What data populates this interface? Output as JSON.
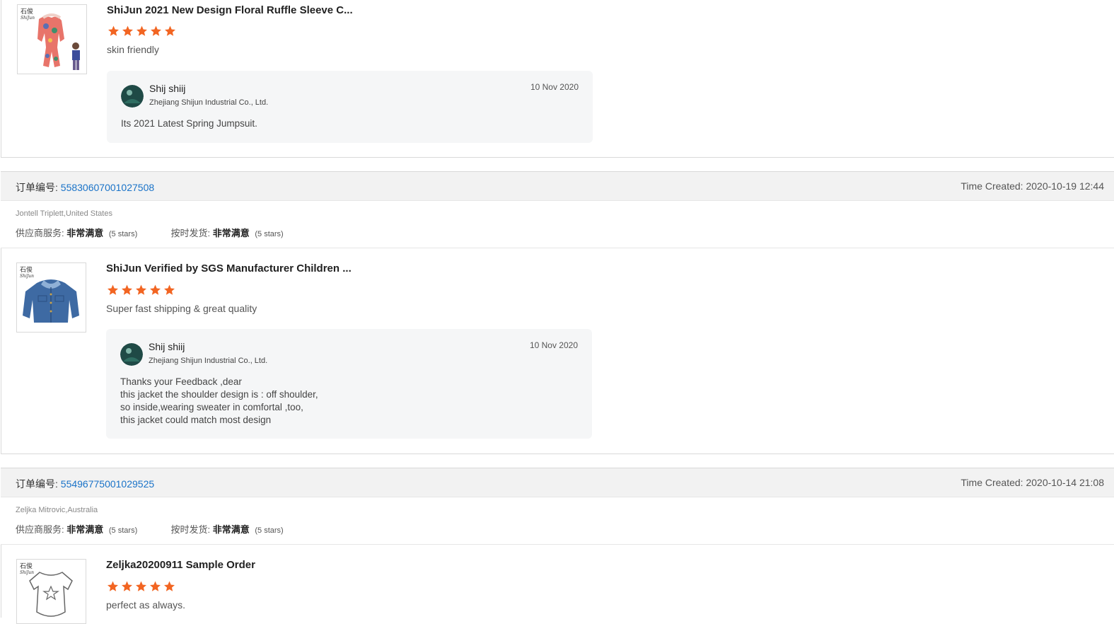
{
  "reviews": [
    {
      "product_title": "ShiJun 2021 New Design Floral Ruffle Sleeve C...",
      "stars": 5,
      "review_text": "skin friendly",
      "thumb_brand": "石俊 ShiJun",
      "reply": {
        "seller_name": "Shij shiij",
        "seller_company": "Zhejiang Shijun Industrial Co., Ltd.",
        "date": "10 Nov 2020",
        "text": "Its 2021 Latest Spring Jumpsuit."
      }
    },
    {
      "order_label": "订单编号:",
      "order_id": "55830607001027508",
      "time_created": "Time Created: 2020-10-19 12:44",
      "buyer": "Jontell Triplett,United States",
      "supplier_service_label": "供应商服务:",
      "supplier_service_value": "非常满意",
      "supplier_service_stars": "(5 stars)",
      "on_time_label": "按时发货:",
      "on_time_value": "非常满意",
      "on_time_stars": "(5 stars)",
      "product_title": "ShiJun Verified by SGS Manufacturer Children ...",
      "stars": 5,
      "review_text": "Super fast shipping & great quality",
      "thumb_brand": "石俊 ShiJun",
      "reply": {
        "seller_name": "Shij shiij",
        "seller_company": "Zhejiang Shijun Industrial Co., Ltd.",
        "date": "10 Nov 2020",
        "text": "Thanks your Feedback ,dear\nthis jacket the shoulder design is : off shoulder,\nso inside,wearing sweater in comfortal ,too,\nthis jacket could match most design"
      }
    },
    {
      "order_label": "订单编号:",
      "order_id": "55496775001029525",
      "time_created": "Time Created: 2020-10-14 21:08",
      "buyer": "Zeljka Mitrovic,Australia",
      "supplier_service_label": "供应商服务:",
      "supplier_service_value": "非常满意",
      "supplier_service_stars": "(5 stars)",
      "on_time_label": "按时发货:",
      "on_time_value": "非常满意",
      "on_time_stars": "(5 stars)",
      "product_title": "Zeljka20200911 Sample Order",
      "stars": 5,
      "review_text": "perfect as always.",
      "thumb_brand": "石俊 ShiJun"
    }
  ],
  "colors": {
    "star": "#f26522",
    "link": "#1a73c8",
    "header_bg": "#f2f2f2",
    "reply_bg": "#f5f6f7"
  },
  "icons": {
    "star": "star-icon",
    "avatar": "seller-avatar"
  }
}
